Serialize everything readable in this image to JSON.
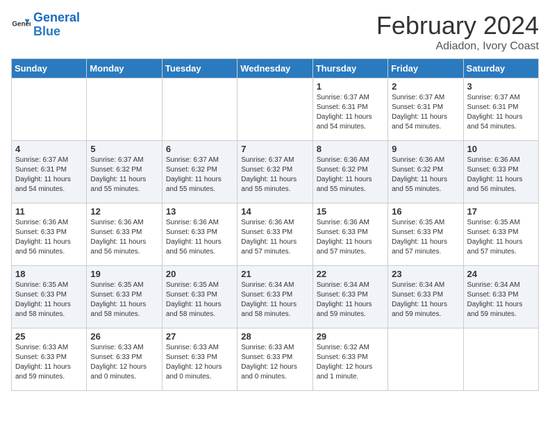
{
  "logo": {
    "text_general": "General",
    "text_blue": "Blue"
  },
  "header": {
    "month_year": "February 2024",
    "location": "Adiadon, Ivory Coast"
  },
  "weekdays": [
    "Sunday",
    "Monday",
    "Tuesday",
    "Wednesday",
    "Thursday",
    "Friday",
    "Saturday"
  ],
  "weeks": [
    [
      {
        "day": "",
        "info": ""
      },
      {
        "day": "",
        "info": ""
      },
      {
        "day": "",
        "info": ""
      },
      {
        "day": "",
        "info": ""
      },
      {
        "day": "1",
        "info": "Sunrise: 6:37 AM\nSunset: 6:31 PM\nDaylight: 11 hours\nand 54 minutes."
      },
      {
        "day": "2",
        "info": "Sunrise: 6:37 AM\nSunset: 6:31 PM\nDaylight: 11 hours\nand 54 minutes."
      },
      {
        "day": "3",
        "info": "Sunrise: 6:37 AM\nSunset: 6:31 PM\nDaylight: 11 hours\nand 54 minutes."
      }
    ],
    [
      {
        "day": "4",
        "info": "Sunrise: 6:37 AM\nSunset: 6:31 PM\nDaylight: 11 hours\nand 54 minutes."
      },
      {
        "day": "5",
        "info": "Sunrise: 6:37 AM\nSunset: 6:32 PM\nDaylight: 11 hours\nand 55 minutes."
      },
      {
        "day": "6",
        "info": "Sunrise: 6:37 AM\nSunset: 6:32 PM\nDaylight: 11 hours\nand 55 minutes."
      },
      {
        "day": "7",
        "info": "Sunrise: 6:37 AM\nSunset: 6:32 PM\nDaylight: 11 hours\nand 55 minutes."
      },
      {
        "day": "8",
        "info": "Sunrise: 6:36 AM\nSunset: 6:32 PM\nDaylight: 11 hours\nand 55 minutes."
      },
      {
        "day": "9",
        "info": "Sunrise: 6:36 AM\nSunset: 6:32 PM\nDaylight: 11 hours\nand 55 minutes."
      },
      {
        "day": "10",
        "info": "Sunrise: 6:36 AM\nSunset: 6:33 PM\nDaylight: 11 hours\nand 56 minutes."
      }
    ],
    [
      {
        "day": "11",
        "info": "Sunrise: 6:36 AM\nSunset: 6:33 PM\nDaylight: 11 hours\nand 56 minutes."
      },
      {
        "day": "12",
        "info": "Sunrise: 6:36 AM\nSunset: 6:33 PM\nDaylight: 11 hours\nand 56 minutes."
      },
      {
        "day": "13",
        "info": "Sunrise: 6:36 AM\nSunset: 6:33 PM\nDaylight: 11 hours\nand 56 minutes."
      },
      {
        "day": "14",
        "info": "Sunrise: 6:36 AM\nSunset: 6:33 PM\nDaylight: 11 hours\nand 57 minutes."
      },
      {
        "day": "15",
        "info": "Sunrise: 6:36 AM\nSunset: 6:33 PM\nDaylight: 11 hours\nand 57 minutes."
      },
      {
        "day": "16",
        "info": "Sunrise: 6:35 AM\nSunset: 6:33 PM\nDaylight: 11 hours\nand 57 minutes."
      },
      {
        "day": "17",
        "info": "Sunrise: 6:35 AM\nSunset: 6:33 PM\nDaylight: 11 hours\nand 57 minutes."
      }
    ],
    [
      {
        "day": "18",
        "info": "Sunrise: 6:35 AM\nSunset: 6:33 PM\nDaylight: 11 hours\nand 58 minutes."
      },
      {
        "day": "19",
        "info": "Sunrise: 6:35 AM\nSunset: 6:33 PM\nDaylight: 11 hours\nand 58 minutes."
      },
      {
        "day": "20",
        "info": "Sunrise: 6:35 AM\nSunset: 6:33 PM\nDaylight: 11 hours\nand 58 minutes."
      },
      {
        "day": "21",
        "info": "Sunrise: 6:34 AM\nSunset: 6:33 PM\nDaylight: 11 hours\nand 58 minutes."
      },
      {
        "day": "22",
        "info": "Sunrise: 6:34 AM\nSunset: 6:33 PM\nDaylight: 11 hours\nand 59 minutes."
      },
      {
        "day": "23",
        "info": "Sunrise: 6:34 AM\nSunset: 6:33 PM\nDaylight: 11 hours\nand 59 minutes."
      },
      {
        "day": "24",
        "info": "Sunrise: 6:34 AM\nSunset: 6:33 PM\nDaylight: 11 hours\nand 59 minutes."
      }
    ],
    [
      {
        "day": "25",
        "info": "Sunrise: 6:33 AM\nSunset: 6:33 PM\nDaylight: 11 hours\nand 59 minutes."
      },
      {
        "day": "26",
        "info": "Sunrise: 6:33 AM\nSunset: 6:33 PM\nDaylight: 12 hours\nand 0 minutes."
      },
      {
        "day": "27",
        "info": "Sunrise: 6:33 AM\nSunset: 6:33 PM\nDaylight: 12 hours\nand 0 minutes."
      },
      {
        "day": "28",
        "info": "Sunrise: 6:33 AM\nSunset: 6:33 PM\nDaylight: 12 hours\nand 0 minutes."
      },
      {
        "day": "29",
        "info": "Sunrise: 6:32 AM\nSunset: 6:33 PM\nDaylight: 12 hours\nand 1 minute."
      },
      {
        "day": "",
        "info": ""
      },
      {
        "day": "",
        "info": ""
      }
    ]
  ]
}
